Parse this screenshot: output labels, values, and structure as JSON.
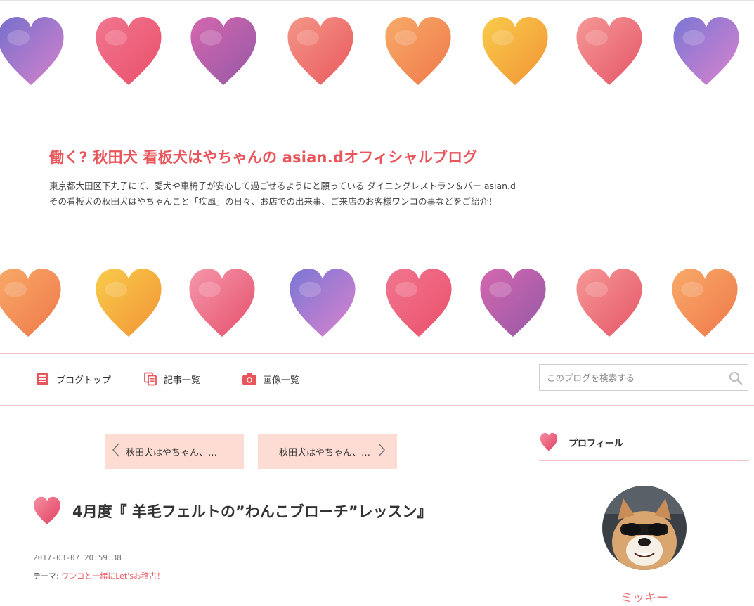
{
  "header": {
    "title": "働く? 秋田犬 看板犬はやちゃんの asian.dオフィシャルブログ",
    "description_line1": "東京都大田区下丸子にて、愛犬や車椅子が安心して過ごせるようにと願っている ダイニングレストラン＆バー asian.d",
    "description_line2": "その看板犬の秋田犬はやちゃんこと「疾風」の日々、お店での出来事、ご来店のお客様ワンコの事などをご紹介！",
    "hearts_top": [
      {
        "icon": "heart-icon",
        "c1": "#6a63c9",
        "c2": "#d377c6"
      },
      {
        "icon": "heart-icon",
        "c1": "#f06a86",
        "c2": "#e8405d"
      },
      {
        "icon": "heart-icon",
        "c1": "#d05aa8",
        "c2": "#8c4a9e"
      },
      {
        "icon": "heart-icon",
        "c1": "#f28d7d",
        "c2": "#e84a4f"
      },
      {
        "icon": "heart-icon",
        "c1": "#f7a35c",
        "c2": "#ee6c3a"
      },
      {
        "icon": "heart-icon",
        "c1": "#f8c73b",
        "c2": "#f08a23"
      },
      {
        "icon": "heart-icon",
        "c1": "#f5908e",
        "c2": "#e24658"
      },
      {
        "icon": "heart-icon",
        "c1": "#6e6bd1",
        "c2": "#d977c9"
      }
    ],
    "hearts_bottom": [
      {
        "icon": "heart-icon",
        "c1": "#f7a35c",
        "c2": "#ee6c3a"
      },
      {
        "icon": "heart-icon",
        "c1": "#f8c73b",
        "c2": "#f08a23"
      },
      {
        "icon": "heart-icon",
        "c1": "#f48ea3",
        "c2": "#e3405f"
      },
      {
        "icon": "heart-icon",
        "c1": "#6e6bd1",
        "c2": "#d977c9"
      },
      {
        "icon": "heart-icon",
        "c1": "#f06a86",
        "c2": "#e8405d"
      },
      {
        "icon": "heart-icon",
        "c1": "#d05aa8",
        "c2": "#8c4a9e"
      },
      {
        "icon": "heart-icon",
        "c1": "#f5908e",
        "c2": "#e24658"
      },
      {
        "icon": "heart-icon",
        "c1": "#f7a35c",
        "c2": "#ee6c3a"
      }
    ]
  },
  "nav": {
    "items": [
      {
        "label": "ブログトップ",
        "icon": "document-icon"
      },
      {
        "label": "記事一覧",
        "icon": "copy-icon"
      },
      {
        "label": "画像一覧",
        "icon": "camera-icon"
      }
    ],
    "search_placeholder": "このブログを検索する",
    "search_icon": "search-icon"
  },
  "pager": {
    "prev_label": "秋田犬はやちゃん、…",
    "next_label": "秋田犬はやちゃん、…"
  },
  "article": {
    "title": "4月度『 羊毛フェルトの”わんこブローチ”レッスン』",
    "date": "2017-03-07 20:59:38",
    "theme_label": "テーマ:",
    "theme_link": "ワンコと一緒にLet'sお稽古！"
  },
  "sidebar": {
    "profile_heading": "プロフィール",
    "profile_name": "ミッキー"
  },
  "colors": {
    "accent": "#e8555a",
    "pager_bg": "#fddcd3",
    "divider": "#f1c8c8"
  }
}
